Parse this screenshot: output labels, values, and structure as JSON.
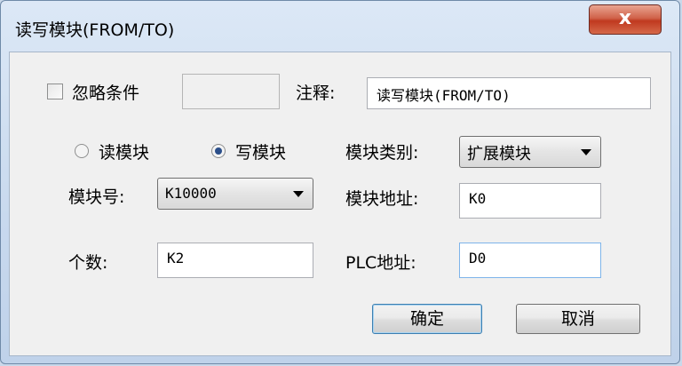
{
  "window": {
    "title": "读写模块(FROM/TO)",
    "close_symbol": "x"
  },
  "form": {
    "ignore_condition": {
      "label": "忽略条件",
      "checked": false,
      "value": ""
    },
    "comment": {
      "label": "注释:",
      "value": "读写模块(FROM/TO)"
    },
    "mode": {
      "read_label": "读模块",
      "write_label": "写模块",
      "selected": "write"
    },
    "module_category": {
      "label": "模块类别:",
      "value": "扩展模块"
    },
    "module_number": {
      "label": "模块号:",
      "value": "K10000"
    },
    "module_address": {
      "label": "模块地址:",
      "value": "K0"
    },
    "count": {
      "label": "个数:",
      "value": "K2"
    },
    "plc_address": {
      "label": "PLC地址:",
      "value": "D0"
    }
  },
  "buttons": {
    "ok": "确定",
    "cancel": "取消"
  }
}
